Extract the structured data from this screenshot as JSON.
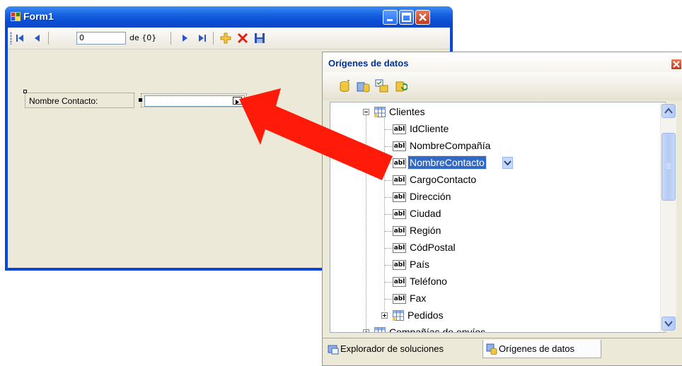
{
  "form1": {
    "title": "Form1",
    "navigator": {
      "position_value": "0",
      "count_label": "de {0}"
    },
    "field_label": "Nombre Contacto:",
    "field_value": ""
  },
  "data_sources": {
    "title": "Orígenes de datos",
    "tree": {
      "table": "Clientes",
      "fields": [
        "IdCliente",
        "NombreCompañía",
        "NombreContacto",
        "CargoContacto",
        "Dirección",
        "Ciudad",
        "Región",
        "CódPostal",
        "País",
        "Teléfono",
        "Fax"
      ],
      "selected_field": "NombreContacto",
      "field_icon_text": "abl",
      "related_table": "Pedidos",
      "next_table": "Compañías de envíos"
    },
    "tabs": [
      {
        "label": "Explorador de soluciones"
      },
      {
        "label": "Orígenes de datos"
      }
    ]
  },
  "colors": {
    "titlebar": "#0a46d6",
    "selection": "#316ac5",
    "arrow": "#ff1a0a"
  }
}
